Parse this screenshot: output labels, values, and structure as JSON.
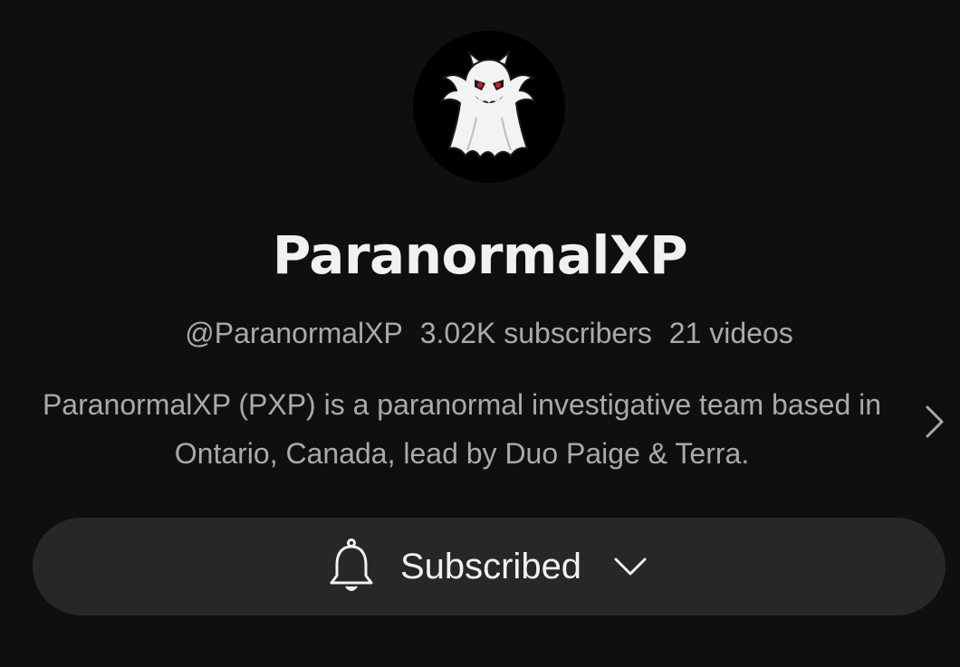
{
  "channel": {
    "name": "ParanormalXP",
    "handle": "@ParanormalXP",
    "subscribers": "3.02K subscribers",
    "videos": "21 videos",
    "description": "ParanormalXP (PXP) is a paranormal investigative team based in Ontario, Canada, lead by Duo Paige & Terra."
  },
  "subscribe_button": {
    "label": "Subscribed",
    "icon": "bell-icon",
    "dropdown_icon": "chevron-down-icon"
  },
  "colors": {
    "background": "#0f0f0f",
    "primary_text": "#f1f1f1",
    "secondary_text": "#aaaaaa",
    "button_background": "#272727",
    "ghost_eyes": "#c81e1e"
  }
}
